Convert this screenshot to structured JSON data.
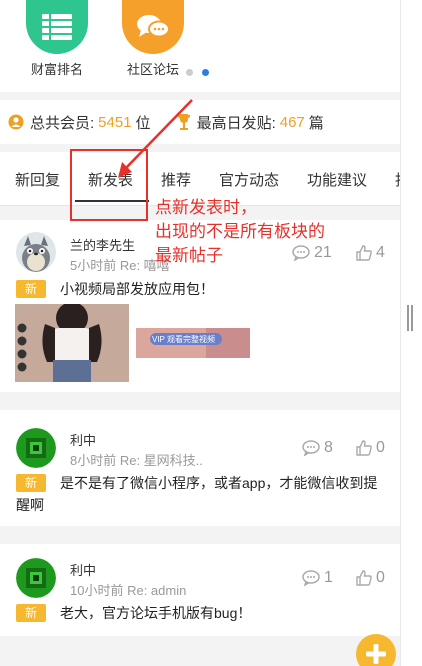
{
  "quicknav": {
    "items": [
      {
        "label": "财富排名",
        "color": "#2ec58e",
        "icon": "list-icon"
      },
      {
        "label": "社区论坛",
        "color": "#f5a02a",
        "icon": "chat-bubbles-icon"
      }
    ],
    "dot_inactive": "#cccccc",
    "dot_active": "#2b7ce9"
  },
  "stats": {
    "members_label": "总共会员:",
    "members_value": "5451",
    "members_unit": "位",
    "maxposts_label": "最高日发贴:",
    "maxposts_value": "467",
    "maxposts_unit": "篇"
  },
  "tabs": [
    "新回复",
    "新发表",
    "推荐",
    "官方动态",
    "功能建议",
    "指"
  ],
  "annotation": {
    "line1": "点新发表时，",
    "line2": "出现的不是所有板块的",
    "line3": "最新帖子",
    "color": "#e8302a"
  },
  "posts": [
    {
      "user": "兰的李先生",
      "meta": "5小时前 Re: 嘻嘻",
      "comments": "21",
      "likes": "4",
      "badge": "新",
      "title": "小视频局部发放应用包！",
      "thumb_caption": "VIP 观看完整视频"
    },
    {
      "user": "利中",
      "meta": "8小时前 Re: 星网科技..",
      "comments": "8",
      "likes": "0",
      "badge": "新",
      "title_line1": "是不是有了微信小程序，或者app，才能微信收到提",
      "title_line2": "醒啊"
    },
    {
      "user": "利中",
      "meta": "10小时前 Re: admin",
      "comments": "1",
      "likes": "0",
      "badge": "新",
      "title": "老大，官方论坛手机版有bug！"
    }
  ]
}
